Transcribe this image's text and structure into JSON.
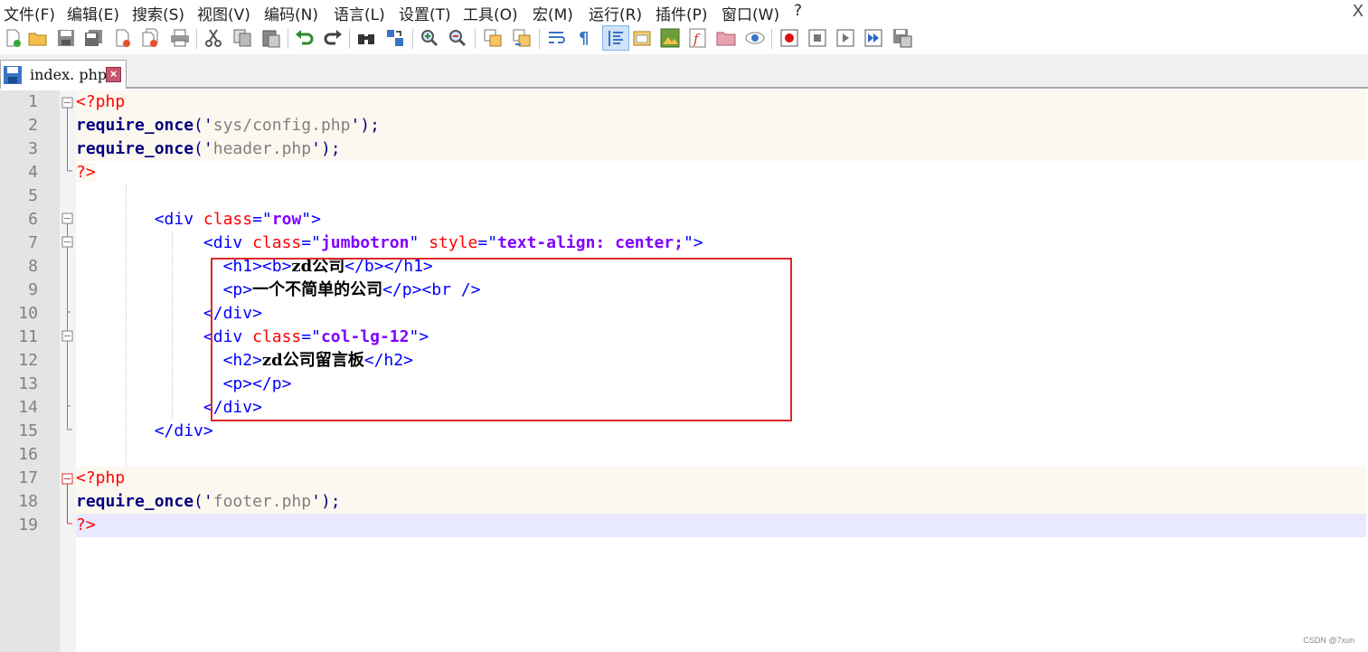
{
  "menu": {
    "items": [
      "文件(F)",
      "编辑(E)",
      "搜索(S)",
      "视图(V)",
      "编码(N)",
      "语言(L)",
      "设置(T)",
      "工具(O)",
      "宏(M)",
      "运行(R)",
      "插件(P)",
      "窗口(W)",
      "?"
    ],
    "close": "X"
  },
  "toolbar": {
    "icons": [
      "new-file-icon",
      "open-file-icon",
      "save-icon",
      "save-all-icon",
      "close-icon",
      "close-all-icon",
      "print-icon",
      "cut-icon",
      "copy-icon",
      "paste-icon",
      "undo-icon",
      "redo-icon",
      "find-icon",
      "replace-icon",
      "zoom-in-icon",
      "zoom-out-icon",
      "sync-vertical-icon",
      "sync-horizontal-icon",
      "word-wrap-icon",
      "show-all-chars-icon",
      "indent-guide-icon",
      "folder-as-workspace-icon",
      "document-map-icon",
      "function-list-icon",
      "folder-icon",
      "monitor-icon",
      "record-macro-icon",
      "stop-macro-icon",
      "play-macro-icon",
      "run-macro-multiple-icon",
      "save-macro-icon"
    ]
  },
  "tab": {
    "label": "index. php",
    "close": "×"
  },
  "editor": {
    "line_numbers": [
      "1",
      "2",
      "3",
      "4",
      "5",
      "6",
      "7",
      "8",
      "9",
      "10",
      "11",
      "12",
      "13",
      "14",
      "15",
      "16",
      "17",
      "18",
      "19"
    ],
    "lines": {
      "l1": {
        "a": "<?php"
      },
      "l2": {
        "a": "require_once",
        "b": "('",
        "c": "sys/config.php",
        "d": "');"
      },
      "l3": {
        "a": "require_once",
        "b": "('",
        "c": "header.php",
        "d": "');"
      },
      "l4": {
        "a": "?>"
      },
      "l6": {
        "indent": "        ",
        "a": "<div ",
        "b": "class",
        "c": "=\"",
        "d": "row",
        "e": "\">"
      },
      "l7": {
        "indent": "             ",
        "a": "<div ",
        "b": "class",
        "c": "=\"",
        "d": "jumbotron",
        "e": "\" ",
        "f": "style",
        "g": "=\"",
        "h": "text-align: center;",
        "i": "\">"
      },
      "l8": {
        "indent": "               ",
        "a": "<h1><b>",
        "b": "zd公司",
        "c": "</b></h1>"
      },
      "l9": {
        "indent": "               ",
        "a": "<p>",
        "b": "一个不简单的公司",
        "c": "</p><br />"
      },
      "l10": {
        "indent": "             ",
        "a": "</div>"
      },
      "l11": {
        "indent": "             ",
        "a": "<div ",
        "b": "class",
        "c": "=\"",
        "d": "col-lg-12",
        "e": "\">"
      },
      "l12": {
        "indent": "               ",
        "a": "<h2>",
        "b": "zd公司留言板",
        "c": "</h2>"
      },
      "l13": {
        "indent": "               ",
        "a": "<p></p>"
      },
      "l14": {
        "indent": "             ",
        "a": "</div>"
      },
      "l15": {
        "indent": "        ",
        "a": "</div>"
      },
      "l17": {
        "a": "<?php"
      },
      "l18": {
        "a": "require_once",
        "b": "('",
        "c": "footer.php",
        "d": "');"
      },
      "l19": {
        "a": "?>"
      }
    }
  },
  "watermark": "CSDN @7xun",
  "colors": {
    "tag": "#0000ff",
    "attribute": "#ff0000",
    "attribute_value": "#8000ff",
    "php_delimiter": "#ff0000",
    "keyword": "#000080",
    "string": "#808080",
    "highlight_box": "#e0262a",
    "current_line": "#e8e8ff"
  }
}
